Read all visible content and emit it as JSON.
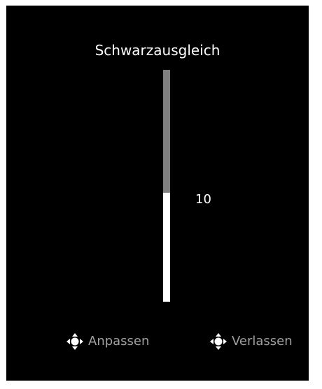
{
  "osd": {
    "title": "Schwarzausgleich",
    "value_label": "10",
    "slider": {
      "level_fraction": 0.47,
      "track_color": "#7f7f7f",
      "fill_color": "#ffffff"
    }
  },
  "hints": {
    "adjust": {
      "icon": "joystick-icon",
      "label": "Anpassen"
    },
    "exit": {
      "icon": "joystick-icon",
      "label": "Verlassen"
    }
  },
  "colors": {
    "background": "#000000",
    "text": "#ffffff",
    "hint_text": "#a0a0a0"
  }
}
